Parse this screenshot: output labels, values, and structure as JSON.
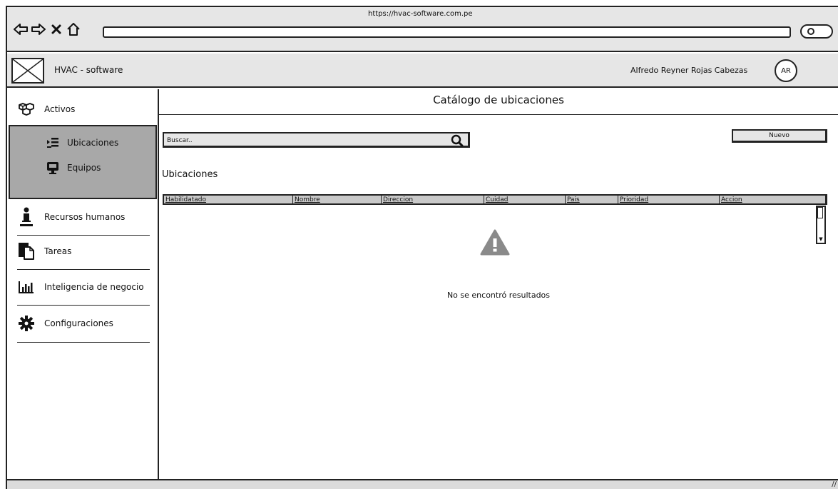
{
  "browser": {
    "url": "https://hvac-software.com.pe",
    "nav_icons": [
      "back-icon",
      "forward-icon",
      "stop-icon",
      "home-icon"
    ]
  },
  "header": {
    "app_title": "HVAC - software",
    "user_name": "Alfredo Reyner Rojas Cabezas",
    "avatar_initials": "AR"
  },
  "sidebar": {
    "activos_label": "Activos",
    "sub_items": [
      {
        "label": "Ubicaciones",
        "icon": "indent-list-icon"
      },
      {
        "label": "Equipos",
        "icon": "monitor-icon"
      }
    ],
    "items": [
      {
        "label": "Recursos humanos",
        "icon": "person-icon"
      },
      {
        "label": "Tareas",
        "icon": "documents-icon"
      },
      {
        "label": "Inteligencia de negocio",
        "icon": "bar-chart-icon"
      },
      {
        "label": "Configuraciones",
        "icon": "gear-icon"
      }
    ]
  },
  "main": {
    "page_title": "Catálogo de ubicaciones",
    "search_placeholder": "Buscar..",
    "new_button": "Nuevo",
    "section_title": "Ubicaciones",
    "columns": [
      "Habilidatado",
      "Nombre",
      "Direccion",
      "Cuidad",
      "Pais",
      "Prioridad",
      "Accion"
    ],
    "empty_message": "No se encontró resultados"
  }
}
